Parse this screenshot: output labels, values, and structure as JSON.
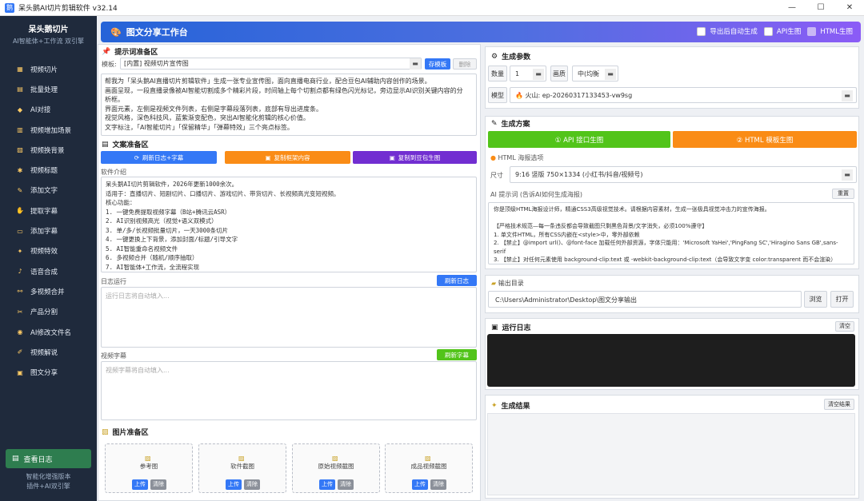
{
  "window": {
    "title": "呆头鹅AI切片剪辑软件 v32.14",
    "min": "—",
    "max": "☐",
    "close": "✕"
  },
  "sidebar": {
    "brand": "呆头鹅切片",
    "subtitle": "AI智能体+工作流 双引擎",
    "items": [
      {
        "label": "视频切片",
        "icon": "▦"
      },
      {
        "label": "批量处理",
        "icon": "▤"
      },
      {
        "label": "AI对接",
        "icon": "◆"
      },
      {
        "label": "视频增加场景",
        "icon": "▥"
      },
      {
        "label": "视频换背景",
        "icon": "▨"
      },
      {
        "label": "视频标题",
        "icon": "✱"
      },
      {
        "label": "添加文字",
        "icon": "✎"
      },
      {
        "label": "提取字幕",
        "icon": "✋"
      },
      {
        "label": "添加字幕",
        "icon": "▭"
      },
      {
        "label": "视频特效",
        "icon": "✦"
      },
      {
        "label": "语音合成",
        "icon": "♪"
      },
      {
        "label": "多视频合并",
        "icon": "⚯"
      },
      {
        "label": "产品分割",
        "icon": "✂"
      },
      {
        "label": "AI修改文件名",
        "icon": "◉"
      },
      {
        "label": "视频解说",
        "icon": "✐"
      },
      {
        "label": "图文分享",
        "icon": "▣"
      }
    ],
    "log_button": "查看日志",
    "footer1": "智能化增强版本",
    "footer2": "插件+AI双引擎"
  },
  "header": {
    "title": "图文分享工作台",
    "opt1": "导出后自动生成",
    "opt2": "API生图",
    "opt3": "HTML生图"
  },
  "prompt": {
    "title": "提示词准备区",
    "template_label": "模板:",
    "template_value": "[内置] 视频切片宣传图",
    "save_btn": "存模板",
    "del_btn": "删除",
    "text": "帮我为「呆头鹅AI直播切片剪辑软件」生成一张专业宣传图，面向直播电商行业，配合豆包AI辅助内容创作的场景。\n画面呈现，一段直播录像被AI智能切割成多个精彩片段，时间轴上每个切割点都有绿色闪光标记，旁边显示AI识别关键内容的分析框。\n界面元素，左侧是视频文件列表，右侧是字幕段落列表，底部有导出进度条。\n视觉风格，深色科技风，蓝紫渐变配色，突出AI智能化剪辑的核心价值。\n文字标注，「AI智能切片」「保留精华」「弹幕特效」三个亮点标签。"
  },
  "copy": {
    "title": "文案准备区",
    "btn1": "刷新日志+字幕",
    "btn2": "复制框架内容",
    "btn3": "复制到豆包生图",
    "intro_label": "软件介绍",
    "intro_text": "呆头鹅AI切片剪辑软件，2026年更新1000余次。\n适用于：直播切片、短剧切片、口播切片、游戏切片、带货切片、长视频高光变短视频。\n核心功能：\n1. 一键免费提取视频字幕（B站+腾讯云ASR）\n2. AI识别视频高光（视觉+语义双模式）\n3. 单/多/长视频批量切片，一天3000条切片\n4. 一键更换上下背景，添加封面/标题/引导文字\n5. AI智能重命名视频文件\n6. 多视频合并（随机/顺序抽取）\n7. AI智能体+工作流，全流程实现",
    "log_label": "日志运行",
    "log_btn": "刷新日志",
    "log_ph": "运行日志将自动填入...",
    "sub_label": "视频字幕",
    "sub_btn": "刷新字幕",
    "sub_ph": "视频字幕将自动填入..."
  },
  "images": {
    "title": "图片准备区",
    "slots": [
      {
        "name": "参考图"
      },
      {
        "name": "软件截图"
      },
      {
        "name": "原始视频截图"
      },
      {
        "name": "成品视频截图"
      }
    ],
    "upload": "上传",
    "clear": "清除"
  },
  "params": {
    "title": "生成参数",
    "count_label": "数量",
    "count_value": "1",
    "quality_label": "画质",
    "quality_value": "中(均衡",
    "model_label": "模型",
    "model_value": "火山: ep-20260317133453-vw9sg"
  },
  "plan": {
    "title": "生成方案",
    "api_btn": "① API 接口生图",
    "html_btn": "② HTML 模板生图",
    "html_opts": "HTML 海报选项",
    "size_label": "尺寸",
    "size_value": "9:16 竖版 750×1334 (小红书/抖音/视频号)",
    "ai_label": "AI 提示词 (告诉AI如何生成海报)",
    "reset_btn": "重置",
    "ai_text": "你是顶级HTML海报设计师，精通CSS3高级视觉技术。请根据内容素材，生成一张极具视觉冲击力的宣传海报。\n\n【严格技术规范—每一条违反都会导致截图只剩黑色背景/文字消失，必须100%遵守】\n1. 单文件HTML，所有CSS内嵌在<style>中，零外部依赖\n2. 【禁止】@import url()、@font-face 加载任何外部资源，字体只能用：'Microsoft YaHei','PingFang SC','Hiragino Sans GB',sans-serif\n3. 【禁止】对任何元素使用 background-clip:text 或 -webkit-background-clip:text（会导致文字变 color:transparent 而不会渲染）"
  },
  "output": {
    "title": "输出目录",
    "path": "C:\\Users\\Administrator\\Desktop\\图文分享输出",
    "browse": "浏览",
    "open": "打开"
  },
  "runlog": {
    "title": "运行日志",
    "clear": "清空"
  },
  "result": {
    "title": "生成结果",
    "clear": "清空结果"
  },
  "colors": {
    "sidebar": "#1f2a3c",
    "accent": "#3478f6",
    "green": "#52c41a",
    "orange": "#fa8c16",
    "purple": "#722ed1",
    "dark": "#1e1e1e"
  }
}
